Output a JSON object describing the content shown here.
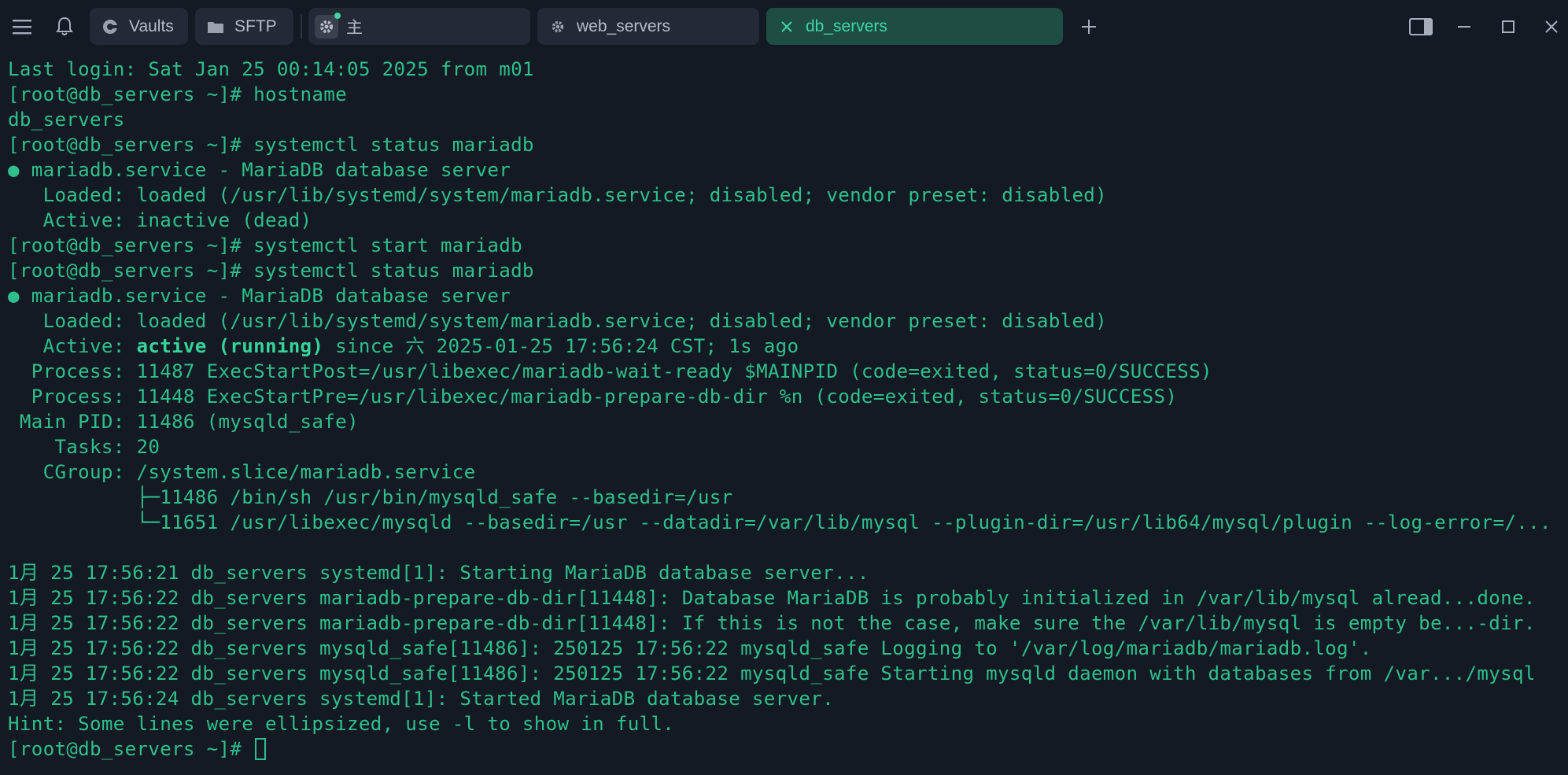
{
  "tabs": {
    "vaults_label": "Vaults",
    "sftp_label": "SFTP",
    "local_label": "主",
    "web_label": "web_servers",
    "db_label": "db_servers"
  },
  "colors": {
    "background": "#141a23",
    "terminal_text": "#2fbf8c",
    "active_tab": "#1e4d44",
    "tab": "#232a35"
  },
  "icons": [
    "menu-icon",
    "bell-icon",
    "vaults-icon",
    "folder-icon",
    "gear-icon",
    "close-icon",
    "plus-icon",
    "sidebar-toggle-icon",
    "minimize-icon",
    "maximize-icon",
    "window-close-icon"
  ],
  "terminal": {
    "lines": [
      "Last login: Sat Jan 25 00:14:05 2025 from m01",
      "[root@db_servers ~]# hostname",
      "db_servers",
      "[root@db_servers ~]# systemctl status mariadb",
      "● mariadb.service - MariaDB database server",
      "   Loaded: loaded (/usr/lib/systemd/system/mariadb.service; disabled; vendor preset: disabled)",
      "   Active: inactive (dead)",
      "[root@db_servers ~]# systemctl start mariadb",
      "[root@db_servers ~]# systemctl status mariadb",
      "● mariadb.service - MariaDB database server",
      "   Loaded: loaded (/usr/lib/systemd/system/mariadb.service; disabled; vendor preset: disabled)",
      "   Active: ",
      "  Process: 11487 ExecStartPost=/usr/libexec/mariadb-wait-ready $MAINPID (code=exited, status=0/SUCCESS)",
      "  Process: 11448 ExecStartPre=/usr/libexec/mariadb-prepare-db-dir %n (code=exited, status=0/SUCCESS)",
      " Main PID: 11486 (mysqld_safe)",
      "    Tasks: 20",
      "   CGroup: /system.slice/mariadb.service",
      "           ├─11486 /bin/sh /usr/bin/mysqld_safe --basedir=/usr",
      "           └─11651 /usr/libexec/mysqld --basedir=/usr --datadir=/var/lib/mysql --plugin-dir=/usr/lib64/mysql/plugin --log-error=/...",
      "",
      "1月 25 17:56:21 db_servers systemd[1]: Starting MariaDB database server...",
      "1月 25 17:56:22 db_servers mariadb-prepare-db-dir[11448]: Database MariaDB is probably initialized in /var/lib/mysql alread...done.",
      "1月 25 17:56:22 db_servers mariadb-prepare-db-dir[11448]: If this is not the case, make sure the /var/lib/mysql is empty be...-dir.",
      "1月 25 17:56:22 db_servers mysqld_safe[11486]: 250125 17:56:22 mysqld_safe Logging to '/var/log/mariadb/mariadb.log'.",
      "1月 25 17:56:22 db_servers mysqld_safe[11486]: 250125 17:56:22 mysqld_safe Starting mysqld daemon with databases from /var.../mysql",
      "1月 25 17:56:24 db_servers systemd[1]: Started MariaDB database server.",
      "Hint: Some lines were ellipsized, use -l to show in full.",
      "[root@db_servers ~]# "
    ],
    "active_state": "active (running)",
    "active_since": " since 六 2025-01-25 17:56:24 CST; 1s ago"
  }
}
